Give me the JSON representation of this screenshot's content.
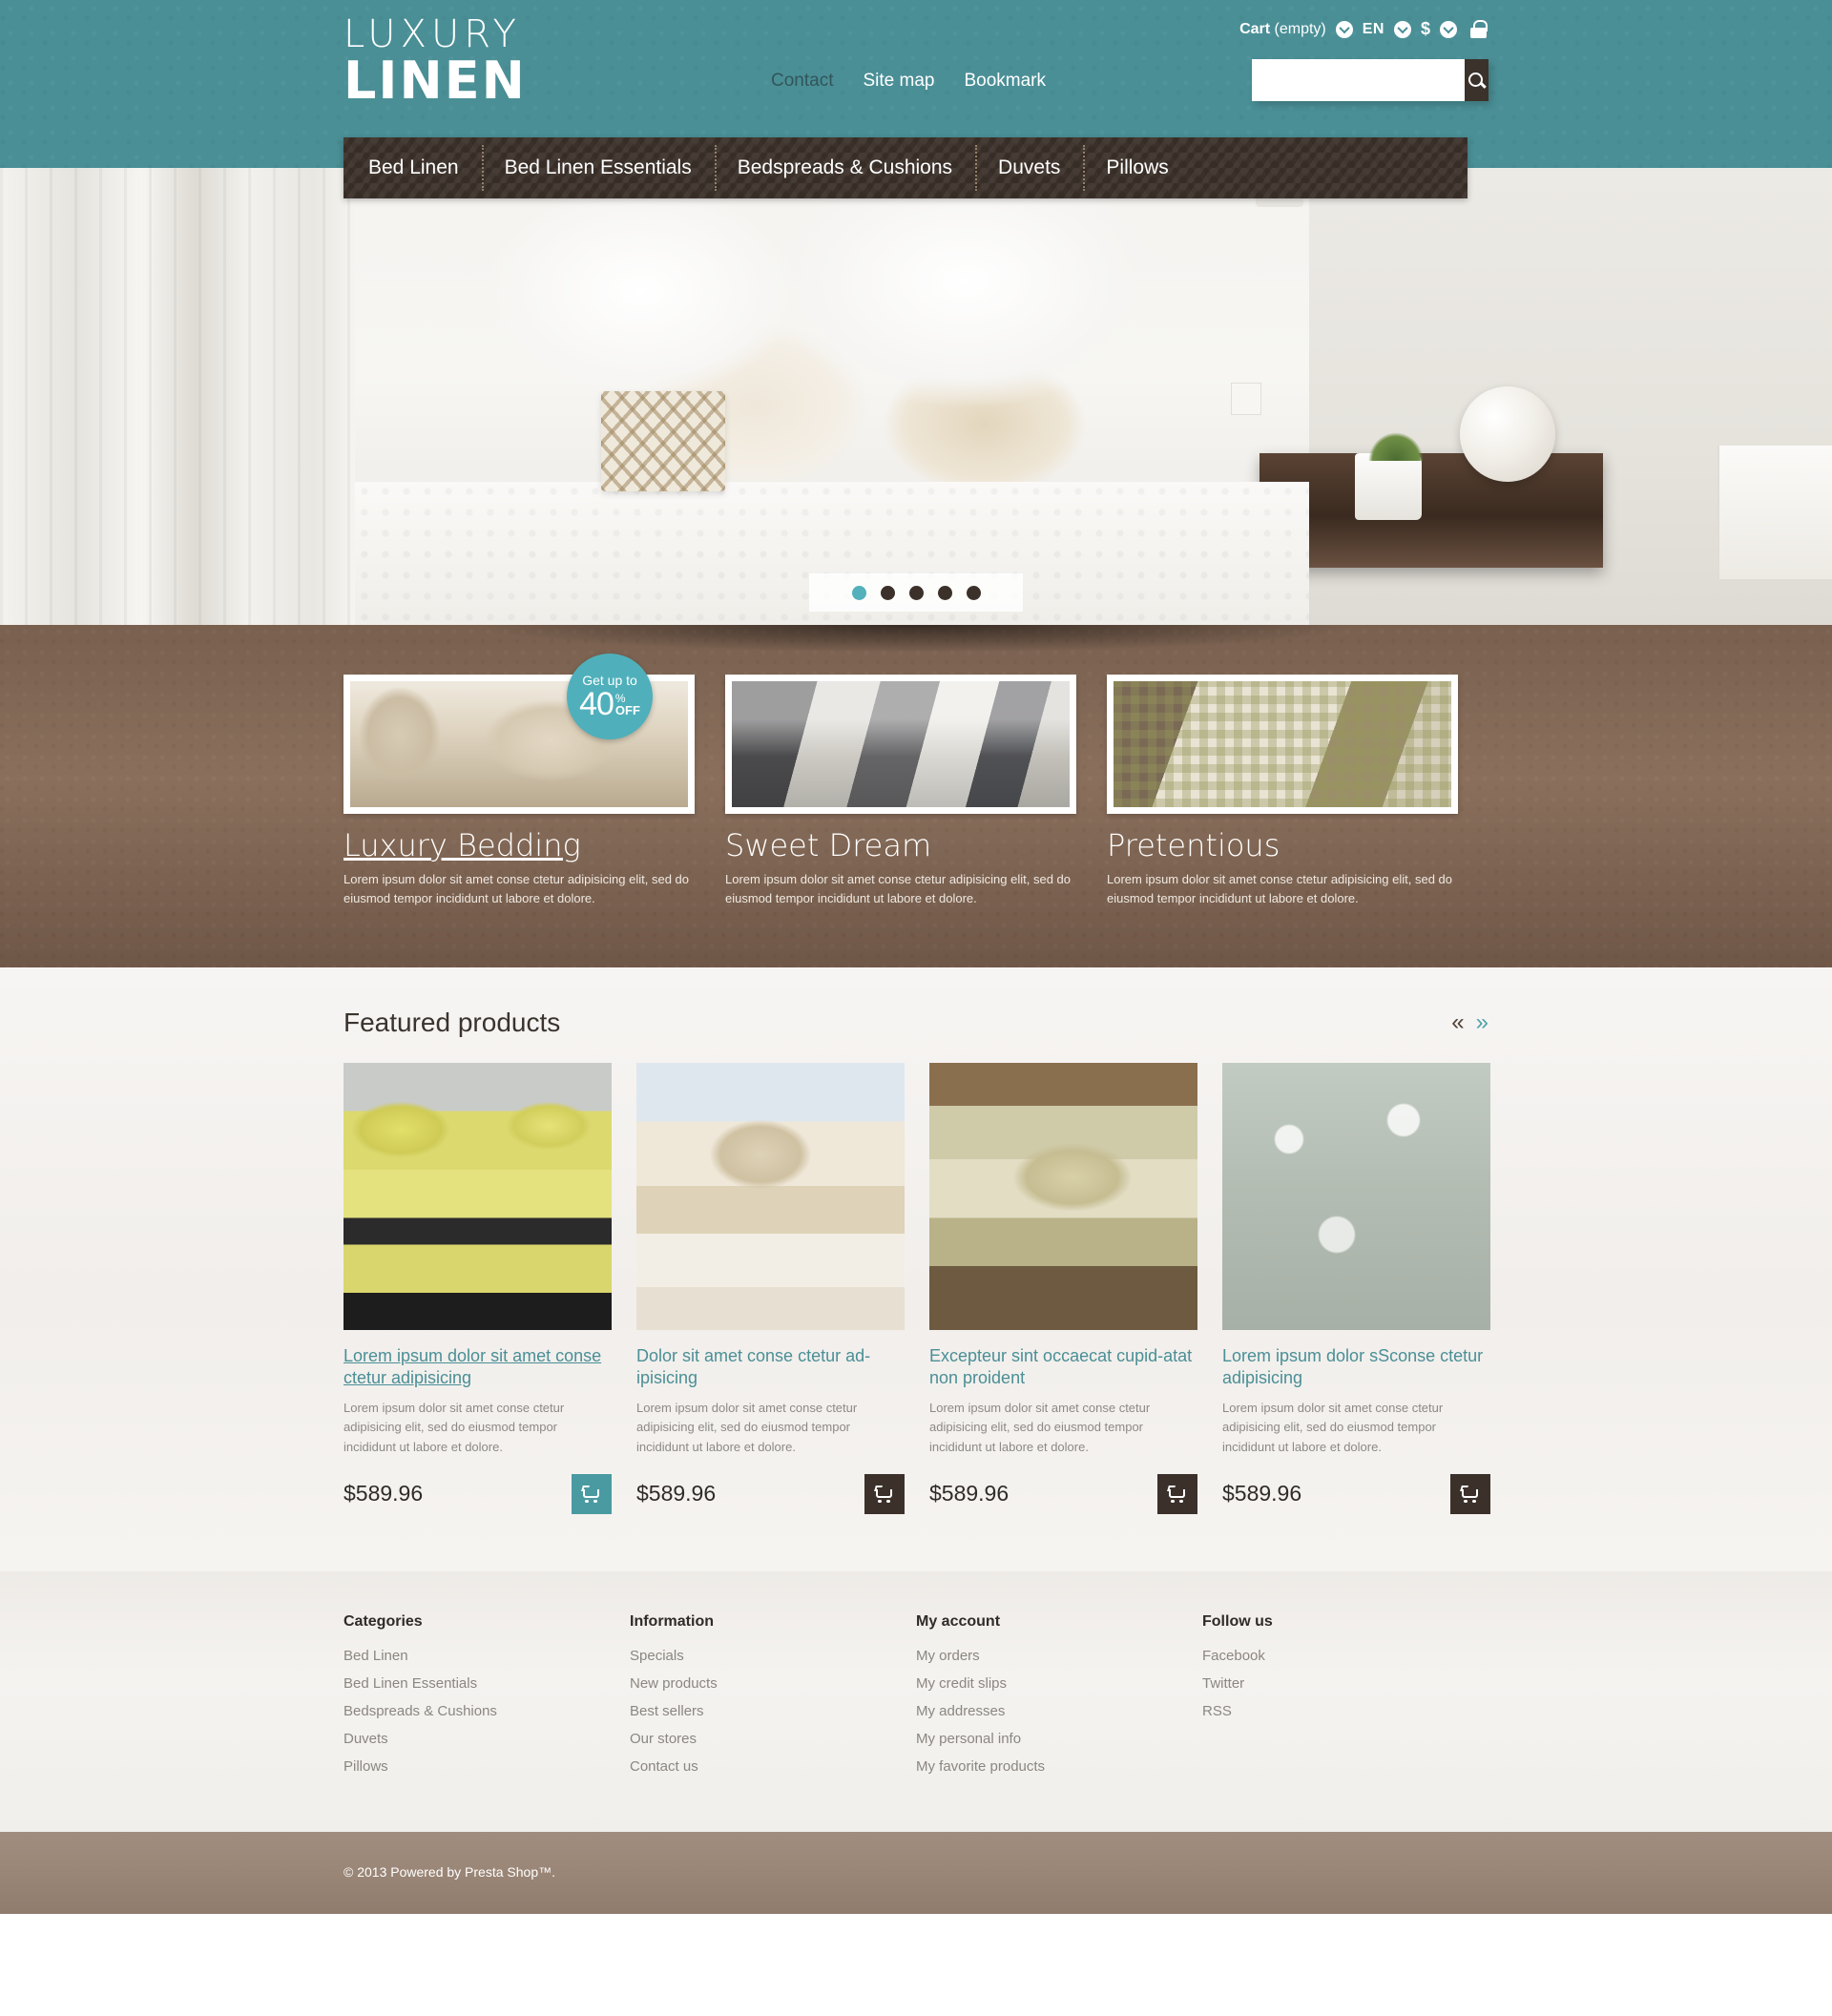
{
  "header": {
    "logo_line1": "LUXURY",
    "logo_line2": "LINEN",
    "topnav": [
      {
        "label": "Contact",
        "state": "active"
      },
      {
        "label": "Site map",
        "state": "normal"
      },
      {
        "label": "Bookmark",
        "state": "normal"
      }
    ],
    "usernav": {
      "cart_label_bold": "Cart",
      "cart_label_rest": " (empty)",
      "language": "EN",
      "currency": "$",
      "lock_icon": "lock-icon",
      "cart_chevron": "chevron-down-circle-icon",
      "lang_chevron": "chevron-down-circle-icon",
      "currency_chevron": "chevron-down-circle-icon"
    },
    "search": {
      "value": "",
      "placeholder": "",
      "button_icon": "search-icon"
    }
  },
  "mainmenu": [
    {
      "label": "Bed Linen"
    },
    {
      "label": "Bed Linen Essentials"
    },
    {
      "label": "Bedspreads & Cushions"
    },
    {
      "label": "Duvets"
    },
    {
      "label": "Pillows"
    }
  ],
  "hero": {
    "dots": [
      {
        "active": true
      },
      {
        "active": false
      },
      {
        "active": false
      },
      {
        "active": false
      },
      {
        "active": false
      }
    ]
  },
  "promo": {
    "badge": {
      "top": "Get up to",
      "number": "40",
      "percent": "%",
      "off": "OFF"
    },
    "blocks": [
      {
        "title": "Luxury Bedding",
        "underline": true,
        "text": "Lorem ipsum dolor sit amet conse ctetur adipisicing elit, sed do eiusmod tempor incididunt ut labore et dolore."
      },
      {
        "title": "Sweet Dream",
        "underline": false,
        "text": "Lorem ipsum dolor sit amet conse ctetur adipisicing elit, sed do eiusmod tempor incididunt ut labore et dolore."
      },
      {
        "title": "Pretentious",
        "underline": false,
        "text": "Lorem ipsum dolor sit amet conse ctetur adipisicing elit, sed do eiusmod tempor incididunt ut labore et dolore."
      }
    ]
  },
  "featured": {
    "title": "Featured products",
    "arrow_prev": "«",
    "arrow_next": "»",
    "products": [
      {
        "name": "Lorem ipsum dolor sit amet conse ctetur adipisicing",
        "underline": true,
        "desc": "Lorem ipsum dolor sit amet conse ctetur adipisicing elit, sed do eiusmod tempor incididunt ut labore et dolore.",
        "price": "$589.96",
        "cart_icon": "shopping-cart-icon",
        "cart_highlighted": true
      },
      {
        "name": "Dolor sit amet conse ctetur ad-ipisicing",
        "underline": false,
        "desc": "Lorem ipsum dolor sit amet conse ctetur adipisicing elit, sed do eiusmod tempor incididunt ut labore et dolore.",
        "price": "$589.96",
        "cart_icon": "shopping-cart-icon",
        "cart_highlighted": false
      },
      {
        "name": "Excepteur sint occaecat cupid-atat non proident",
        "underline": false,
        "desc": "Lorem ipsum dolor sit amet conse ctetur adipisicing elit, sed do eiusmod tempor incididunt ut labore et dolore.",
        "price": "$589.96",
        "cart_icon": "shopping-cart-icon",
        "cart_highlighted": false
      },
      {
        "name": "Lorem ipsum dolor sSconse ctetur adipisicing",
        "underline": false,
        "desc": "Lorem ipsum dolor sit amet conse ctetur adipisicing elit, sed do eiusmod tempor incididunt ut labore et dolore.",
        "price": "$589.96",
        "cart_icon": "shopping-cart-icon",
        "cart_highlighted": false
      }
    ]
  },
  "footer": {
    "columns": [
      {
        "heading": "Categories",
        "links": [
          "Bed Linen",
          "Bed Linen Essentials",
          "Bedspreads & Cushions",
          "Duvets",
          "Pillows"
        ]
      },
      {
        "heading": "Information",
        "links": [
          "Specials",
          "New products",
          "Best sellers",
          "Our stores",
          "Contact us"
        ]
      },
      {
        "heading": "My account",
        "links": [
          "My orders",
          "My credit slips",
          "My addresses",
          "My personal info",
          "My favorite products"
        ]
      },
      {
        "heading": "Follow us",
        "links": [
          "Facebook",
          "Twitter",
          "RSS"
        ]
      }
    ],
    "copyright": "© 2013 Powered by Presta Shop™."
  },
  "colors": {
    "teal": "#4a8f96",
    "teal_light": "#4fb0bb",
    "brown_dark": "#3b312a",
    "brown_promo": "#7d6352",
    "copyright_bar": "#9b8778"
  }
}
